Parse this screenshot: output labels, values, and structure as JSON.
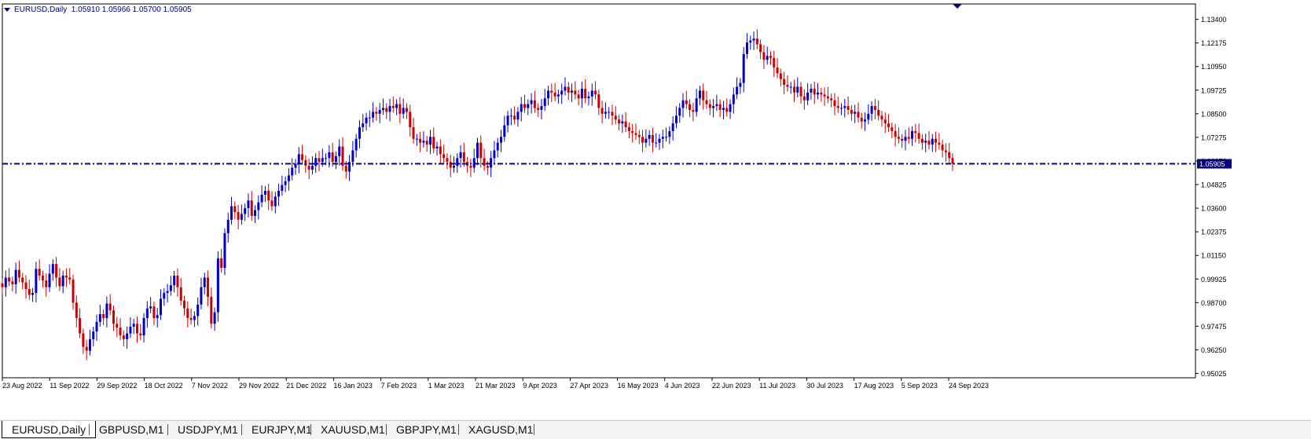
{
  "header": {
    "symbol": "EURUSD,Daily",
    "ohlc": "1.05910 1.05966 1.05700 1.05905"
  },
  "price_tag": "1.05905",
  "tabs": [
    {
      "label": "EURUSD,Daily",
      "active": true
    },
    {
      "label": "GBPUSD,M1",
      "active": false
    },
    {
      "label": "USDJPY,M1",
      "active": false
    },
    {
      "label": "EURJPY,M1",
      "active": false
    },
    {
      "label": "XAUUSD,M1",
      "active": false
    },
    {
      "label": "GBPJPY,M1",
      "active": false
    },
    {
      "label": "XAGUSD,M1",
      "active": false
    }
  ],
  "colors": {
    "bull": "#0000cd",
    "bear": "#cc0000",
    "axis": "#000080",
    "price_line": "#000080"
  },
  "chart_data": {
    "type": "candlestick",
    "ylim": [
      0.948,
      1.142
    ],
    "yticks": [
      "1.13400",
      "1.12175",
      "1.10950",
      "1.09725",
      "1.08500",
      "1.07275",
      "1.06050",
      "1.04825",
      "1.03600",
      "1.02375",
      "1.01150",
      "0.99925",
      "0.98700",
      "0.97475",
      "0.96250",
      "0.95025"
    ],
    "xticks": [
      "23 Aug 2022",
      "11 Sep 2022",
      "29 Sep 2022",
      "18 Oct 2022",
      "7 Nov 2022",
      "29 Nov 2022",
      "21 Dec 2022",
      "16 Jan 2023",
      "7 Feb 2023",
      "1 Mar 2023",
      "21 Mar 2023",
      "9 Apr 2023",
      "27 Apr 2023",
      "16 May 2023",
      "4 Jun 2023",
      "22 Jun 2023",
      "11 Jul 2023",
      "30 Jul 2023",
      "17 Aug 2023",
      "5 Sep 2023",
      "24 Sep 2023"
    ],
    "current_price": 1.05905,
    "closes": [
      0.995,
      1.0,
      0.998,
      0.9965,
      1.004,
      1.0,
      0.9975,
      0.994,
      0.991,
      0.992,
      1.0045,
      1.001,
      0.9985,
      0.995,
      1.002,
      1.007,
      1.0,
      0.9955,
      1.001,
      1.0,
      0.999,
      0.987,
      0.979,
      0.971,
      0.964,
      0.962,
      0.968,
      0.972,
      0.977,
      0.981,
      0.979,
      0.9865,
      0.983,
      0.976,
      0.974,
      0.97,
      0.968,
      0.971,
      0.9745,
      0.976,
      0.971,
      0.97,
      0.979,
      0.984,
      0.985,
      0.979,
      0.9805,
      0.989,
      0.992,
      0.993,
      0.996,
      1.001,
      0.995,
      0.988,
      0.984,
      0.979,
      0.978,
      0.98,
      0.986,
      0.995,
      1.0,
      0.99,
      0.976,
      0.982,
      1.01,
      1.005,
      1.023,
      1.03,
      1.037,
      1.034,
      1.03,
      1.033,
      1.036,
      1.04,
      1.032,
      1.035,
      1.039,
      1.043,
      1.045,
      1.04,
      1.037,
      1.042,
      1.045,
      1.048,
      1.05,
      1.053,
      1.057,
      1.059,
      1.064,
      1.061,
      1.058,
      1.056,
      1.058,
      1.062,
      1.06,
      1.062,
      1.062,
      1.065,
      1.06,
      1.063,
      1.068,
      1.058,
      1.055,
      1.06,
      1.066,
      1.072,
      1.078,
      1.08,
      1.083,
      1.083,
      1.086,
      1.085,
      1.087,
      1.088,
      1.086,
      1.089,
      1.088,
      1.09,
      1.085,
      1.088,
      1.086,
      1.078,
      1.072,
      1.072,
      1.07,
      1.071,
      1.069,
      1.073,
      1.067,
      1.068,
      1.064,
      1.062,
      1.06,
      1.057,
      1.058,
      1.062,
      1.065,
      1.06,
      1.058,
      1.057,
      1.062,
      1.07,
      1.062,
      1.058,
      1.057,
      1.062,
      1.066,
      1.07,
      1.073,
      1.079,
      1.084,
      1.084,
      1.082,
      1.086,
      1.09,
      1.088,
      1.09,
      1.092,
      1.088,
      1.087,
      1.089,
      1.093,
      1.097,
      1.096,
      1.094,
      1.095,
      1.097,
      1.099,
      1.096,
      1.097,
      1.095,
      1.093,
      1.098,
      1.093,
      1.094,
      1.097,
      1.095,
      1.088,
      1.085,
      1.086,
      1.086,
      1.084,
      1.082,
      1.08,
      1.081,
      1.078,
      1.076,
      1.075,
      1.074,
      1.073,
      1.07,
      1.072,
      1.074,
      1.07,
      1.07,
      1.072,
      1.073,
      1.073,
      1.076,
      1.08,
      1.084,
      1.088,
      1.092,
      1.09,
      1.087,
      1.086,
      1.093,
      1.097,
      1.092,
      1.09,
      1.088,
      1.089,
      1.09,
      1.087,
      1.088,
      1.086,
      1.09,
      1.095,
      1.099,
      1.101,
      1.116,
      1.122,
      1.123,
      1.124,
      1.121,
      1.117,
      1.113,
      1.115,
      1.114,
      1.109,
      1.106,
      1.103,
      1.1,
      1.099,
      1.099,
      1.096,
      1.099,
      1.094,
      1.092,
      1.096,
      1.098,
      1.095,
      1.096,
      1.095,
      1.094,
      1.093,
      1.092,
      1.089,
      1.088,
      1.088,
      1.089,
      1.087,
      1.085,
      1.086,
      1.083,
      1.081,
      1.082,
      1.085,
      1.089,
      1.087,
      1.084,
      1.082,
      1.08,
      1.078,
      1.076,
      1.073,
      1.072,
      1.071,
      1.073,
      1.072,
      1.076,
      1.075,
      1.072,
      1.07,
      1.071,
      1.069,
      1.072,
      1.07,
      1.069,
      1.066,
      1.065,
      1.062,
      1.059
    ]
  }
}
